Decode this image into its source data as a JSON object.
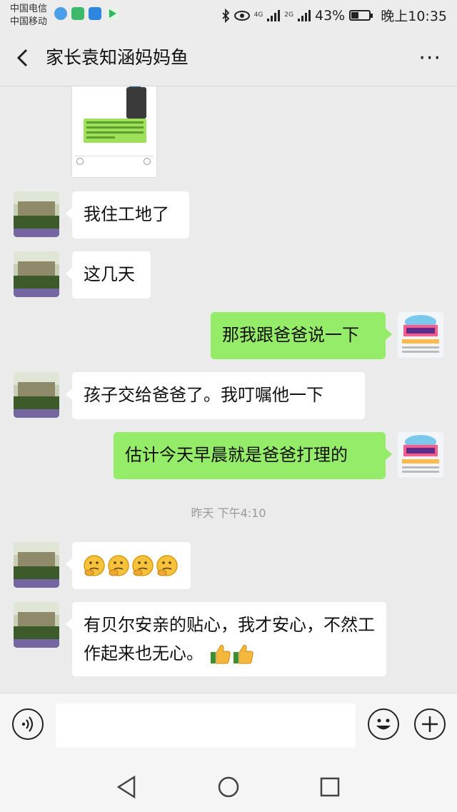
{
  "status": {
    "carrier_1": "中国电信",
    "carrier_2": "中国移动",
    "network_1": "4G",
    "network_2": "2G",
    "battery": "43%",
    "battery_level": 0.43,
    "time": "晚上10:35"
  },
  "header": {
    "title": "家长袁知涵妈妈鱼",
    "more_label": "···"
  },
  "messages": [
    {
      "side": "left",
      "text": "我住工地了"
    },
    {
      "side": "left",
      "text": "这几天"
    },
    {
      "side": "right",
      "text": "那我跟爸爸说一下"
    },
    {
      "side": "left",
      "text": "孩子交给爸爸了。我叮嘱他一下"
    },
    {
      "side": "right",
      "text": "估计今天早晨就是爸爸打理的"
    },
    {
      "side": "left",
      "emoji": "thinking-face x4"
    },
    {
      "side": "left",
      "text": "有贝尔安亲的贴心，我才安心，不然工作起来也无心。",
      "emoji": "thumbs-up x2"
    }
  ],
  "timestamp": "昨天 下午4:10",
  "colors": {
    "right_bubble": "#95ec69",
    "left_bubble": "#ffffff",
    "background": "#ebebeb"
  }
}
